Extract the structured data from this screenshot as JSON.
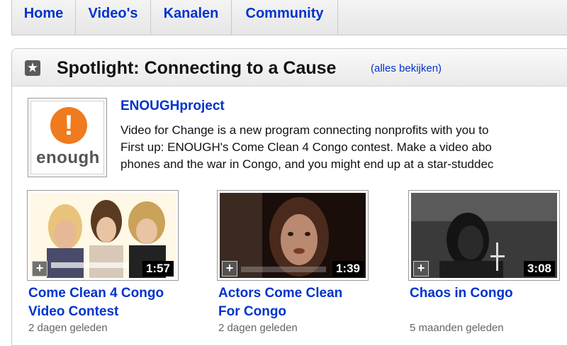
{
  "nav": {
    "tabs": [
      {
        "label": "Home"
      },
      {
        "label": "Video's"
      },
      {
        "label": "Kanalen"
      },
      {
        "label": "Community"
      }
    ]
  },
  "spotlight": {
    "title": "Spotlight: Connecting to a Cause",
    "view_all": "(alles bekijken)",
    "icon": "spotlight-icon"
  },
  "channel": {
    "name": "ENOUGHproject",
    "logo_text": "enough",
    "logo_color": "#f07a1e",
    "description_lines": [
      "Video for Change is a new program connecting nonprofits with you to",
      "First up: ENOUGH's Come Clean 4 Congo contest. Make a video abo",
      "phones and the war in Congo, and you might end up at a star-studdec"
    ]
  },
  "videos": [
    {
      "title_lines": [
        "Come Clean 4 Congo",
        "Video Contest"
      ],
      "duration": "1:57",
      "date": "2 dagen geleden"
    },
    {
      "title_lines": [
        "Actors Come Clean",
        "For Congo"
      ],
      "duration": "1:39",
      "date": "2 dagen geleden"
    },
    {
      "title_lines": [
        "Chaos in Congo"
      ],
      "duration": "3:08",
      "date": "5 maanden geleden"
    }
  ],
  "colors": {
    "link": "#0033cc",
    "accent_orange": "#f07a1e"
  }
}
